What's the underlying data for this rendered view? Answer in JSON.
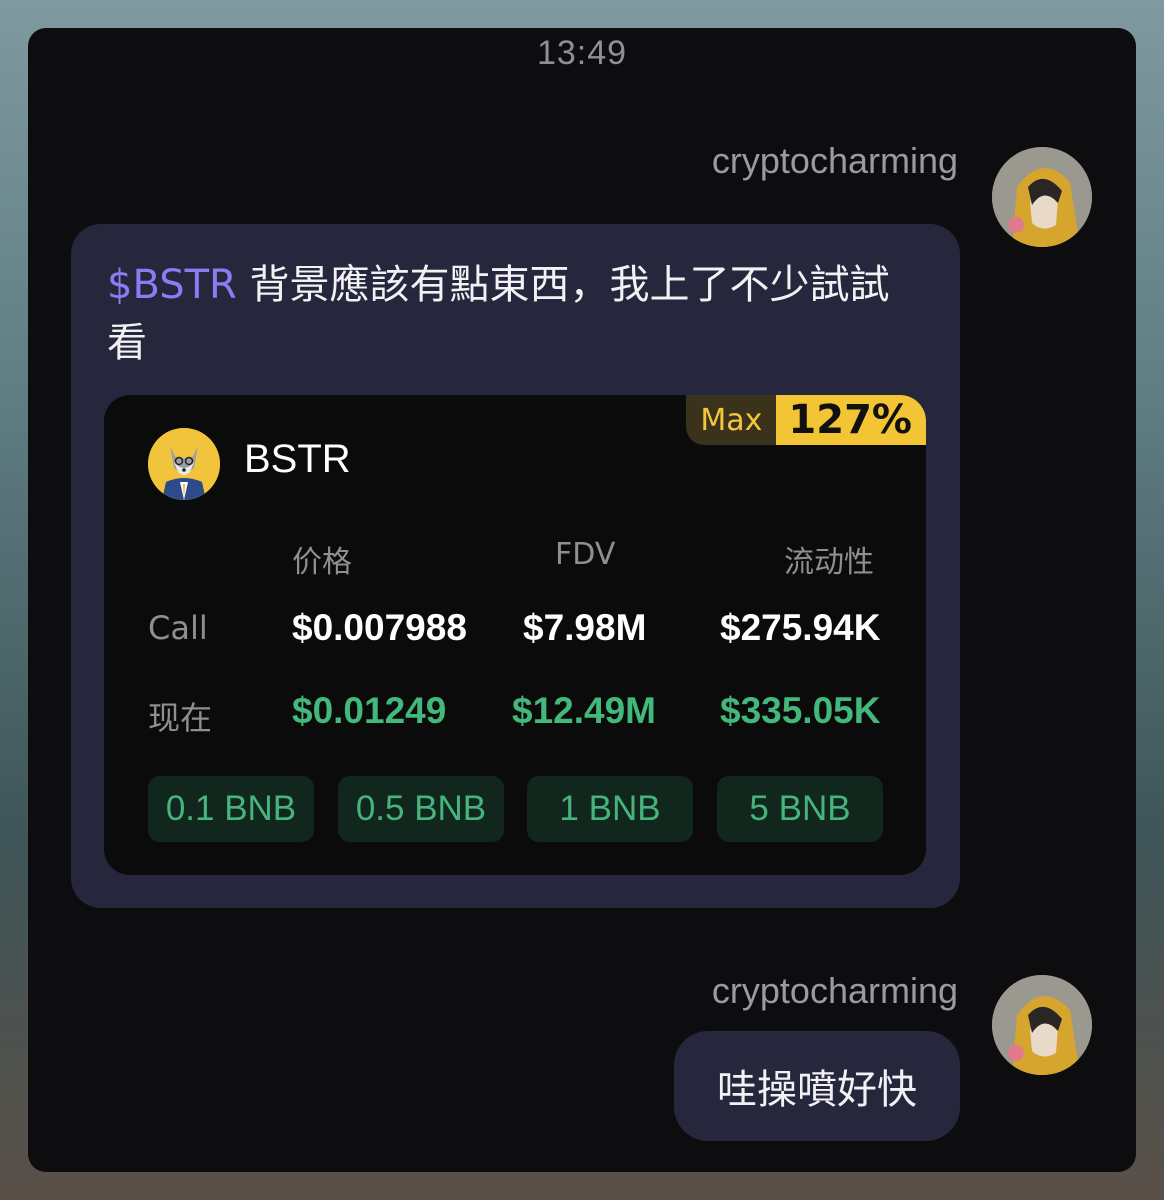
{
  "chat": {
    "time": "13:49",
    "messages": [
      {
        "sender": "cryptocharming",
        "ticker": "$BSTR",
        "text": " 背景應該有點東西，我上了不少試試看",
        "card": {
          "max_label": "Max",
          "max_value": "127%",
          "token_name": "BSTR",
          "columns": [
            "价格",
            "FDV",
            "流动性"
          ],
          "rows": [
            {
              "label": "Call",
              "values": [
                "$0.007988",
                "$7.98M",
                "$275.94K"
              ]
            },
            {
              "label": "现在",
              "values": [
                "$0.01249",
                "$12.49M",
                "$335.05K"
              ]
            }
          ],
          "buy_buttons": [
            "0.1 BNB",
            "0.5 BNB",
            "1 BNB",
            "5 BNB"
          ]
        }
      },
      {
        "sender": "cryptocharming",
        "text": "哇操噴好快"
      }
    ]
  },
  "colors": {
    "ticker": "#8a7cf2",
    "gain_green": "#42b87a",
    "badge_yellow": "#f3c433",
    "bubble": "#26273c"
  }
}
